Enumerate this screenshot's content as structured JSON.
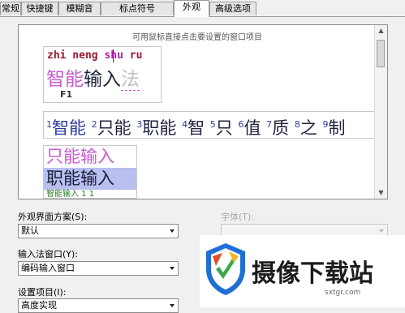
{
  "tabs": [
    {
      "label": "常规"
    },
    {
      "label": "快捷键"
    },
    {
      "label": "模糊音"
    },
    {
      "label": "标点符号"
    },
    {
      "label": "外观"
    },
    {
      "label": "高级选项"
    }
  ],
  "active_tab": "外观",
  "preview": {
    "hint": "可用鼠标直接点击要设置的窗口项目",
    "composition": {
      "pinyin_main": "zhi neng ",
      "pinyin_partial": "shu",
      "pinyin_rest": " ru",
      "text_a": "智能",
      "text_b": "输入",
      "text_c": "法",
      "key_hint": "F1"
    },
    "candidates": [
      {
        "num": "1",
        "word": "智能"
      },
      {
        "num": "2",
        "word": "只能"
      },
      {
        "num": "3",
        "word": "职能"
      },
      {
        "num": "4",
        "word": "智"
      },
      {
        "num": "5",
        "word": "只"
      },
      {
        "num": "6",
        "word": "值"
      },
      {
        "num": "7",
        "word": "质"
      },
      {
        "num": "8",
        "word": "之"
      },
      {
        "num": "9",
        "word": "制"
      }
    ],
    "vertical_candidates": [
      "只能输入",
      "职能输入",
      "智能输入 1 1"
    ]
  },
  "form": {
    "scheme_label": "外观界面方案(S):",
    "scheme_value": "默认",
    "font_label": "字体(T):",
    "font_value": "",
    "window_label": "输入法窗口(Y):",
    "window_value": "编码输入窗口",
    "items_label": "设置项目(I):",
    "items_value": "高度实现"
  },
  "watermark": {
    "name": "摄像下载站",
    "url": "sxtgr.com",
    "colors": {
      "blue": "#1f6fd6",
      "green": "#3aa84a",
      "red": "#e64a2b",
      "yellow": "#f3b61f"
    }
  }
}
